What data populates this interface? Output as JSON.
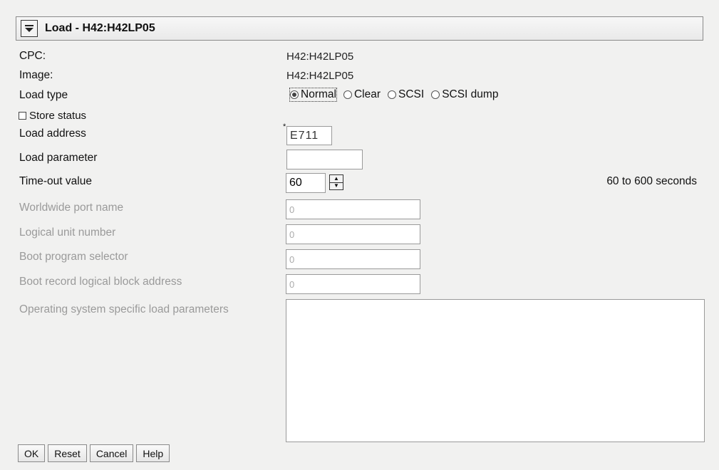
{
  "window": {
    "title": "Load - H42:H42LP05"
  },
  "fields": {
    "cpc": {
      "label": "CPC:",
      "value": "H42:H42LP05"
    },
    "image": {
      "label": "Image:",
      "value": "H42:H42LP05"
    },
    "load_type": {
      "label": "Load type",
      "options": [
        "Normal",
        "Clear",
        "SCSI",
        "SCSI dump"
      ],
      "selected": "Normal"
    },
    "store_status": {
      "label": "Store status",
      "checked": false
    },
    "load_address": {
      "label": "Load address",
      "value": "E711",
      "required_marker": "*"
    },
    "load_parameter": {
      "label": "Load parameter",
      "value": ""
    },
    "timeout": {
      "label": "Time-out value",
      "value": "60",
      "hint": "60 to 600 seconds"
    },
    "wwpn": {
      "label": "Worldwide port name",
      "value": "0"
    },
    "lun": {
      "label": "Logical unit number",
      "value": "0"
    },
    "boot_program": {
      "label": "Boot program selector",
      "value": "0"
    },
    "boot_record": {
      "label": "Boot record logical block address",
      "value": "0"
    },
    "os_params": {
      "label": "Operating system specific load parameters",
      "value": ""
    }
  },
  "buttons": {
    "ok": "OK",
    "reset": "Reset",
    "cancel": "Cancel",
    "help": "Help"
  }
}
